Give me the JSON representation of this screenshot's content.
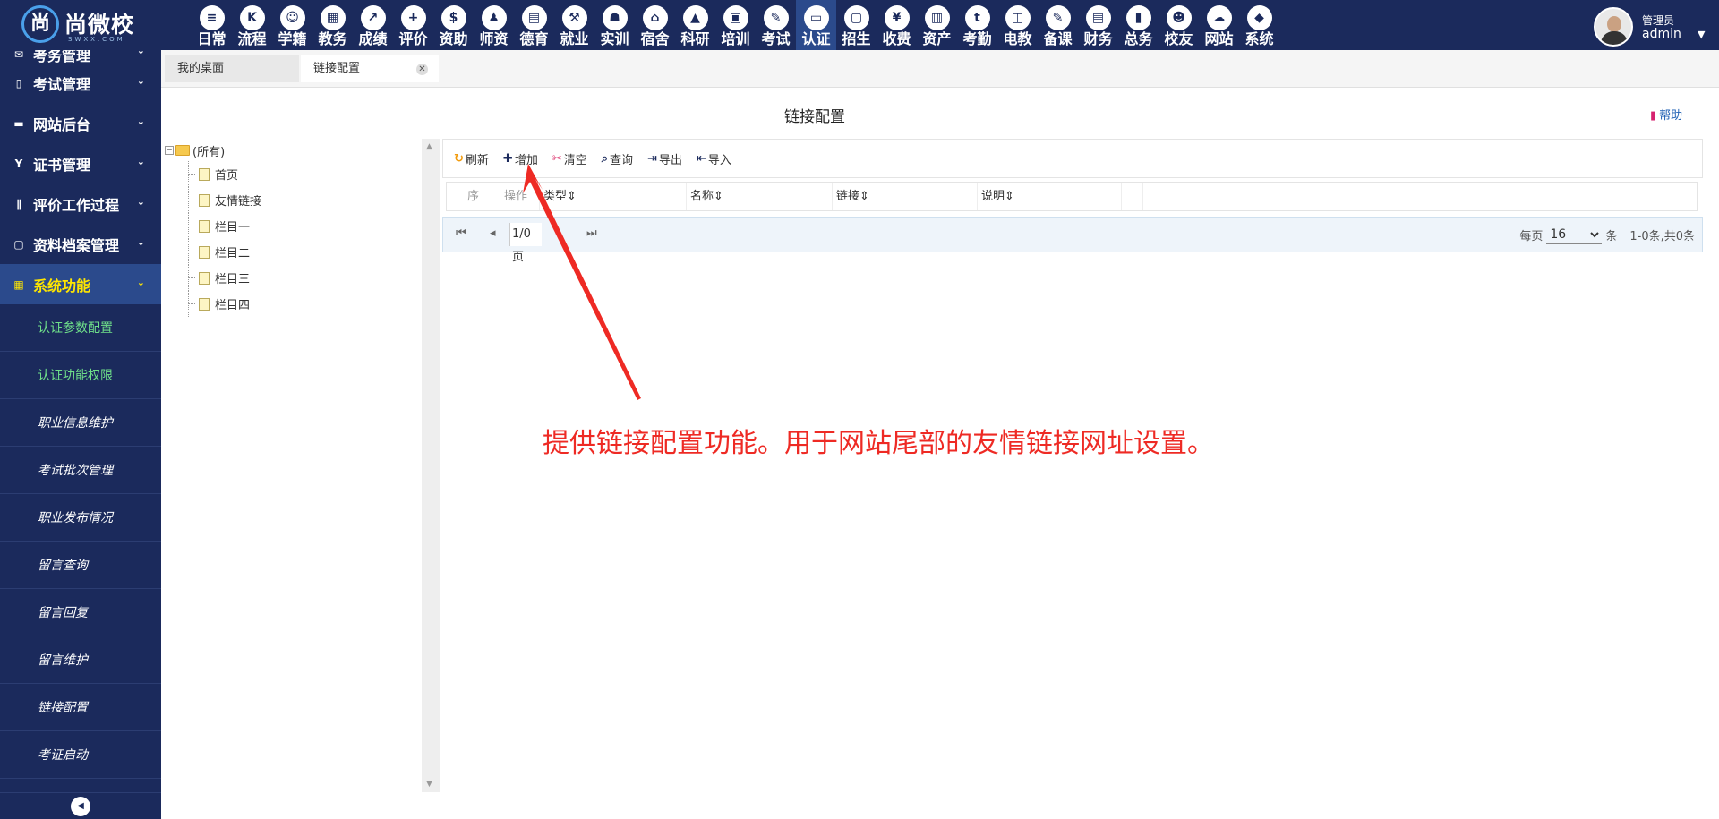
{
  "logo": {
    "mark": "尚",
    "text": "尚微校",
    "sub": "SWXX.COM"
  },
  "modules": [
    {
      "label": "日常",
      "icon": "document-icon",
      "glyph": "≡"
    },
    {
      "label": "流程",
      "icon": "flow-icon",
      "glyph": "K"
    },
    {
      "label": "学籍",
      "icon": "student-icon",
      "glyph": "☺"
    },
    {
      "label": "教务",
      "icon": "calendar-icon",
      "glyph": "▦"
    },
    {
      "label": "成绩",
      "icon": "chart-icon",
      "glyph": "↗"
    },
    {
      "label": "评价",
      "icon": "calendar-plus-icon",
      "glyph": "+"
    },
    {
      "label": "资助",
      "icon": "aid-icon",
      "glyph": "$"
    },
    {
      "label": "师资",
      "icon": "teacher-icon",
      "glyph": "♟"
    },
    {
      "label": "德育",
      "icon": "book-icon",
      "glyph": "▤"
    },
    {
      "label": "就业",
      "icon": "hammer-icon",
      "glyph": "⚒"
    },
    {
      "label": "实训",
      "icon": "robot-icon",
      "glyph": "☗"
    },
    {
      "label": "宿舍",
      "icon": "home-icon",
      "glyph": "⌂"
    },
    {
      "label": "科研",
      "icon": "graduation-cap-icon",
      "glyph": "▲"
    },
    {
      "label": "培训",
      "icon": "image-icon",
      "glyph": "▣"
    },
    {
      "label": "考试",
      "icon": "key-icon",
      "glyph": "✎"
    },
    {
      "label": "认证",
      "icon": "monitor-icon",
      "glyph": "▭"
    },
    {
      "label": "招生",
      "icon": "bus-icon",
      "glyph": "▢"
    },
    {
      "label": "收费",
      "icon": "yen-icon",
      "glyph": "¥"
    },
    {
      "label": "资产",
      "icon": "train-icon",
      "glyph": "▥"
    },
    {
      "label": "考勤",
      "icon": "tumblr-icon",
      "glyph": "t"
    },
    {
      "label": "电教",
      "icon": "file-media-icon",
      "glyph": "◫"
    },
    {
      "label": "备课",
      "icon": "edit-icon",
      "glyph": "✎"
    },
    {
      "label": "财务",
      "icon": "newspaper-icon",
      "glyph": "▤"
    },
    {
      "label": "总务",
      "icon": "bar-chart-icon",
      "glyph": "▮"
    },
    {
      "label": "校友",
      "icon": "users-icon",
      "glyph": "☻"
    },
    {
      "label": "网站",
      "icon": "cloud-icon",
      "glyph": "☁"
    },
    {
      "label": "系统",
      "icon": "cube-icon",
      "glyph": "◆"
    }
  ],
  "user": {
    "role": "管理员",
    "name": "admin"
  },
  "sidebar": {
    "groups": [
      {
        "label": "考务管理",
        "icon": "envelope-icon",
        "glyph": "✉"
      },
      {
        "label": "考试管理",
        "icon": "file-icon",
        "glyph": "▯"
      },
      {
        "label": "网站后台",
        "icon": "folder-icon",
        "glyph": "▬"
      },
      {
        "label": "证书管理",
        "icon": "certificate-icon",
        "glyph": "Y"
      },
      {
        "label": "评价工作过程",
        "icon": "columns-icon",
        "glyph": "∥"
      },
      {
        "label": "资料档案管理",
        "icon": "archive-icon",
        "glyph": "▢"
      },
      {
        "label": "系统功能",
        "icon": "grid-icon",
        "glyph": "▦"
      }
    ],
    "items": [
      "认证参数配置",
      "认证功能权限",
      "职业信息维护",
      "考试批次管理",
      "职业发布情况",
      "留言查询",
      "留言回复",
      "留言维护",
      "链接配置",
      "考证启动"
    ]
  },
  "tabs": [
    {
      "label": "我的桌面"
    },
    {
      "label": "链接配置"
    }
  ],
  "page": {
    "title": "链接配置",
    "help": "帮助"
  },
  "tree": {
    "root": "(所有)",
    "items": [
      "首页",
      "友情链接",
      "栏目一",
      "栏目二",
      "栏目三",
      "栏目四"
    ]
  },
  "toolbar": {
    "refresh": "刷新",
    "add": "增加",
    "clear": "清空",
    "query": "查询",
    "export": "导出",
    "import": "导入"
  },
  "grid": {
    "columns": [
      "序",
      "操作",
      "类型",
      "名称",
      "链接",
      "说明"
    ]
  },
  "pager": {
    "page_info": "1/0页",
    "per_page_label": "每页",
    "per_page": "16",
    "per_page_unit": "条",
    "summary": "1-0条,共0条"
  },
  "annotation": "提供链接配置功能。用于网站尾部的友情链接网址设置。",
  "colors": {
    "header": "#1b2a5c",
    "active": "#2b4a8c",
    "annotation": "#ee2a24",
    "highlight": "#ffe600"
  }
}
